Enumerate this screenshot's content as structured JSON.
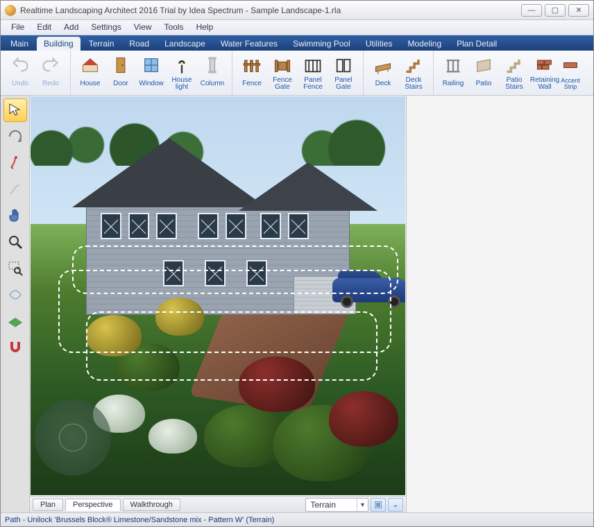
{
  "window": {
    "title": "Realtime Landscaping Architect 2016 Trial by Idea Spectrum - Sample Landscape-1.rla"
  },
  "menu": [
    "File",
    "Edit",
    "Add",
    "Settings",
    "View",
    "Tools",
    "Help"
  ],
  "tabs": [
    "Main",
    "Building",
    "Terrain",
    "Road",
    "Landscape",
    "Water Features",
    "Swimming Pool",
    "Utilities",
    "Modeling",
    "Plan Detail"
  ],
  "active_tab": "Building",
  "ribbon": {
    "history": {
      "undo": "Undo",
      "redo": "Redo"
    },
    "building": [
      "House",
      "Door",
      "Window",
      "House light",
      "Column"
    ],
    "fence": [
      "Fence",
      "Fence Gate",
      "Panel Fence",
      "Panel Gate"
    ],
    "deck": [
      "Deck",
      "Deck Stairs"
    ],
    "patio": [
      "Railing",
      "Patio",
      "Patio Stairs",
      "Retaining Wall",
      "Accent Strip"
    ]
  },
  "side_tools": [
    "select",
    "orbit",
    "walk",
    "path-edit",
    "pan",
    "zoom",
    "zoom-region",
    "fly",
    "grid",
    "snap"
  ],
  "active_side": "select",
  "view_tabs": [
    "Plan",
    "Perspective",
    "Walkthrough"
  ],
  "active_view": "Perspective",
  "layer_combo": "Terrain",
  "status": "Path - Unilock 'Brussels Block® Limestone/Sandstone mix - Pattern W' (Terrain)"
}
